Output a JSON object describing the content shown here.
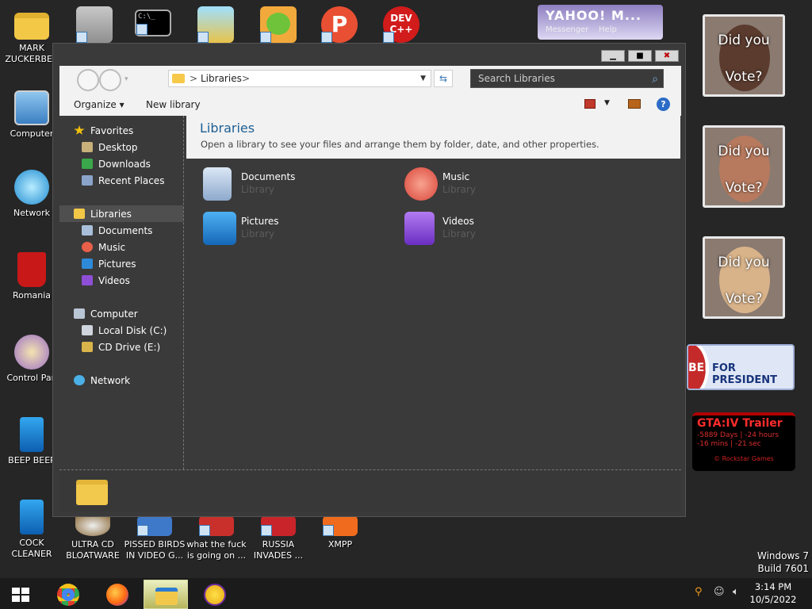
{
  "desktop_icons": [
    {
      "label": "MARK ZUCKERBER",
      "icon": "folder-icon"
    },
    {
      "label": "Computer",
      "icon": "computer-icon"
    },
    {
      "label": "Network",
      "icon": "network-icon"
    },
    {
      "label": "Romania",
      "icon": "recycle-bin-icon"
    },
    {
      "label": "Control Pan",
      "icon": "control-panel-icon"
    },
    {
      "label": "BEEP BEEP",
      "icon": "app-icon"
    },
    {
      "label": "COCK CLEANER",
      "icon": "app-icon"
    },
    {
      "label": "ULTRA CD BLOATWARE",
      "icon": "cd-icon"
    },
    {
      "label": "PISSED BIRDS IN VIDEO G...",
      "icon": "game-icon"
    },
    {
      "label": "what the fuck is going on ...",
      "icon": "game-icon"
    },
    {
      "label": "RUSSIA INVADES ...",
      "icon": "game-icon"
    },
    {
      "label": "XMPP",
      "icon": "app-icon"
    }
  ],
  "top_shortcuts": [
    {
      "name": "settings-shortcut-icon"
    },
    {
      "name": "cmd-shortcut-icon",
      "text": "C:\\_"
    },
    {
      "name": "app-shortcut-icon"
    },
    {
      "name": "pig-game-shortcut-icon"
    },
    {
      "name": "p-app-shortcut-icon",
      "text": "P"
    },
    {
      "name": "devcpp-shortcut-icon",
      "text": "DEV C++"
    }
  ],
  "gadgets": {
    "yahoo": {
      "logo": "YAHOO! M...",
      "messenger": "Messenger",
      "help": "Help"
    },
    "vote_cards": [
      {
        "line1": "Did you",
        "line2": "Vote?",
        "color": "#5a3b2e"
      },
      {
        "line1": "Did you",
        "line2": "Vote?",
        "color": "#b77a5e"
      },
      {
        "line1": "Did you",
        "line2": "Vote?",
        "color": "#d8b38a"
      }
    ],
    "bee": {
      "prefix": "BEE",
      "text": "FOR PRESIDENT"
    },
    "gta": {
      "title": "GTA:IV Trailer",
      "line1": "-5889 Days | -24 hours",
      "line2": "-16 mins | -21 sec",
      "footer": "© Rockstar Games"
    }
  },
  "explorer": {
    "controls": {
      "minimize": "▁",
      "maximize": "■",
      "close": "✖"
    },
    "address": {
      "crumb": "Libraries",
      "sep": ">"
    },
    "search_placeholder": "Search Libraries",
    "toolbar": {
      "organize": "Organize ▾",
      "new_library": "New library",
      "help": "?"
    },
    "sidebar": {
      "favorites": "Favorites",
      "favorites_items": [
        "Desktop",
        "Downloads",
        "Recent Places"
      ],
      "libraries": "Libraries",
      "libraries_items": [
        "Documents",
        "Music",
        "Pictures",
        "Videos"
      ],
      "computer": "Computer",
      "computer_items": [
        "Local Disk (C:)",
        "CD Drive (E:)"
      ],
      "network": "Network"
    },
    "content": {
      "title": "Libraries",
      "description": "Open a library to see your files and arrange them by folder, date, and other properties.",
      "libraries": [
        {
          "name": "Documents",
          "type": "Library"
        },
        {
          "name": "Music",
          "type": "Library"
        },
        {
          "name": "Pictures",
          "type": "Library"
        },
        {
          "name": "Videos",
          "type": "Library"
        }
      ]
    }
  },
  "taskbar": {
    "apps": [
      "chrome-icon",
      "firefox-icon",
      "explorer-icon",
      "yahoo-messenger-icon"
    ],
    "clock_time": "3:14 PM",
    "clock_date": "10/5/2022"
  },
  "watermark": {
    "line1": "Windows 7",
    "line2": "Build 7601"
  },
  "colors": {
    "accent": "#1d5e93",
    "selection": "#4f4f4f"
  }
}
